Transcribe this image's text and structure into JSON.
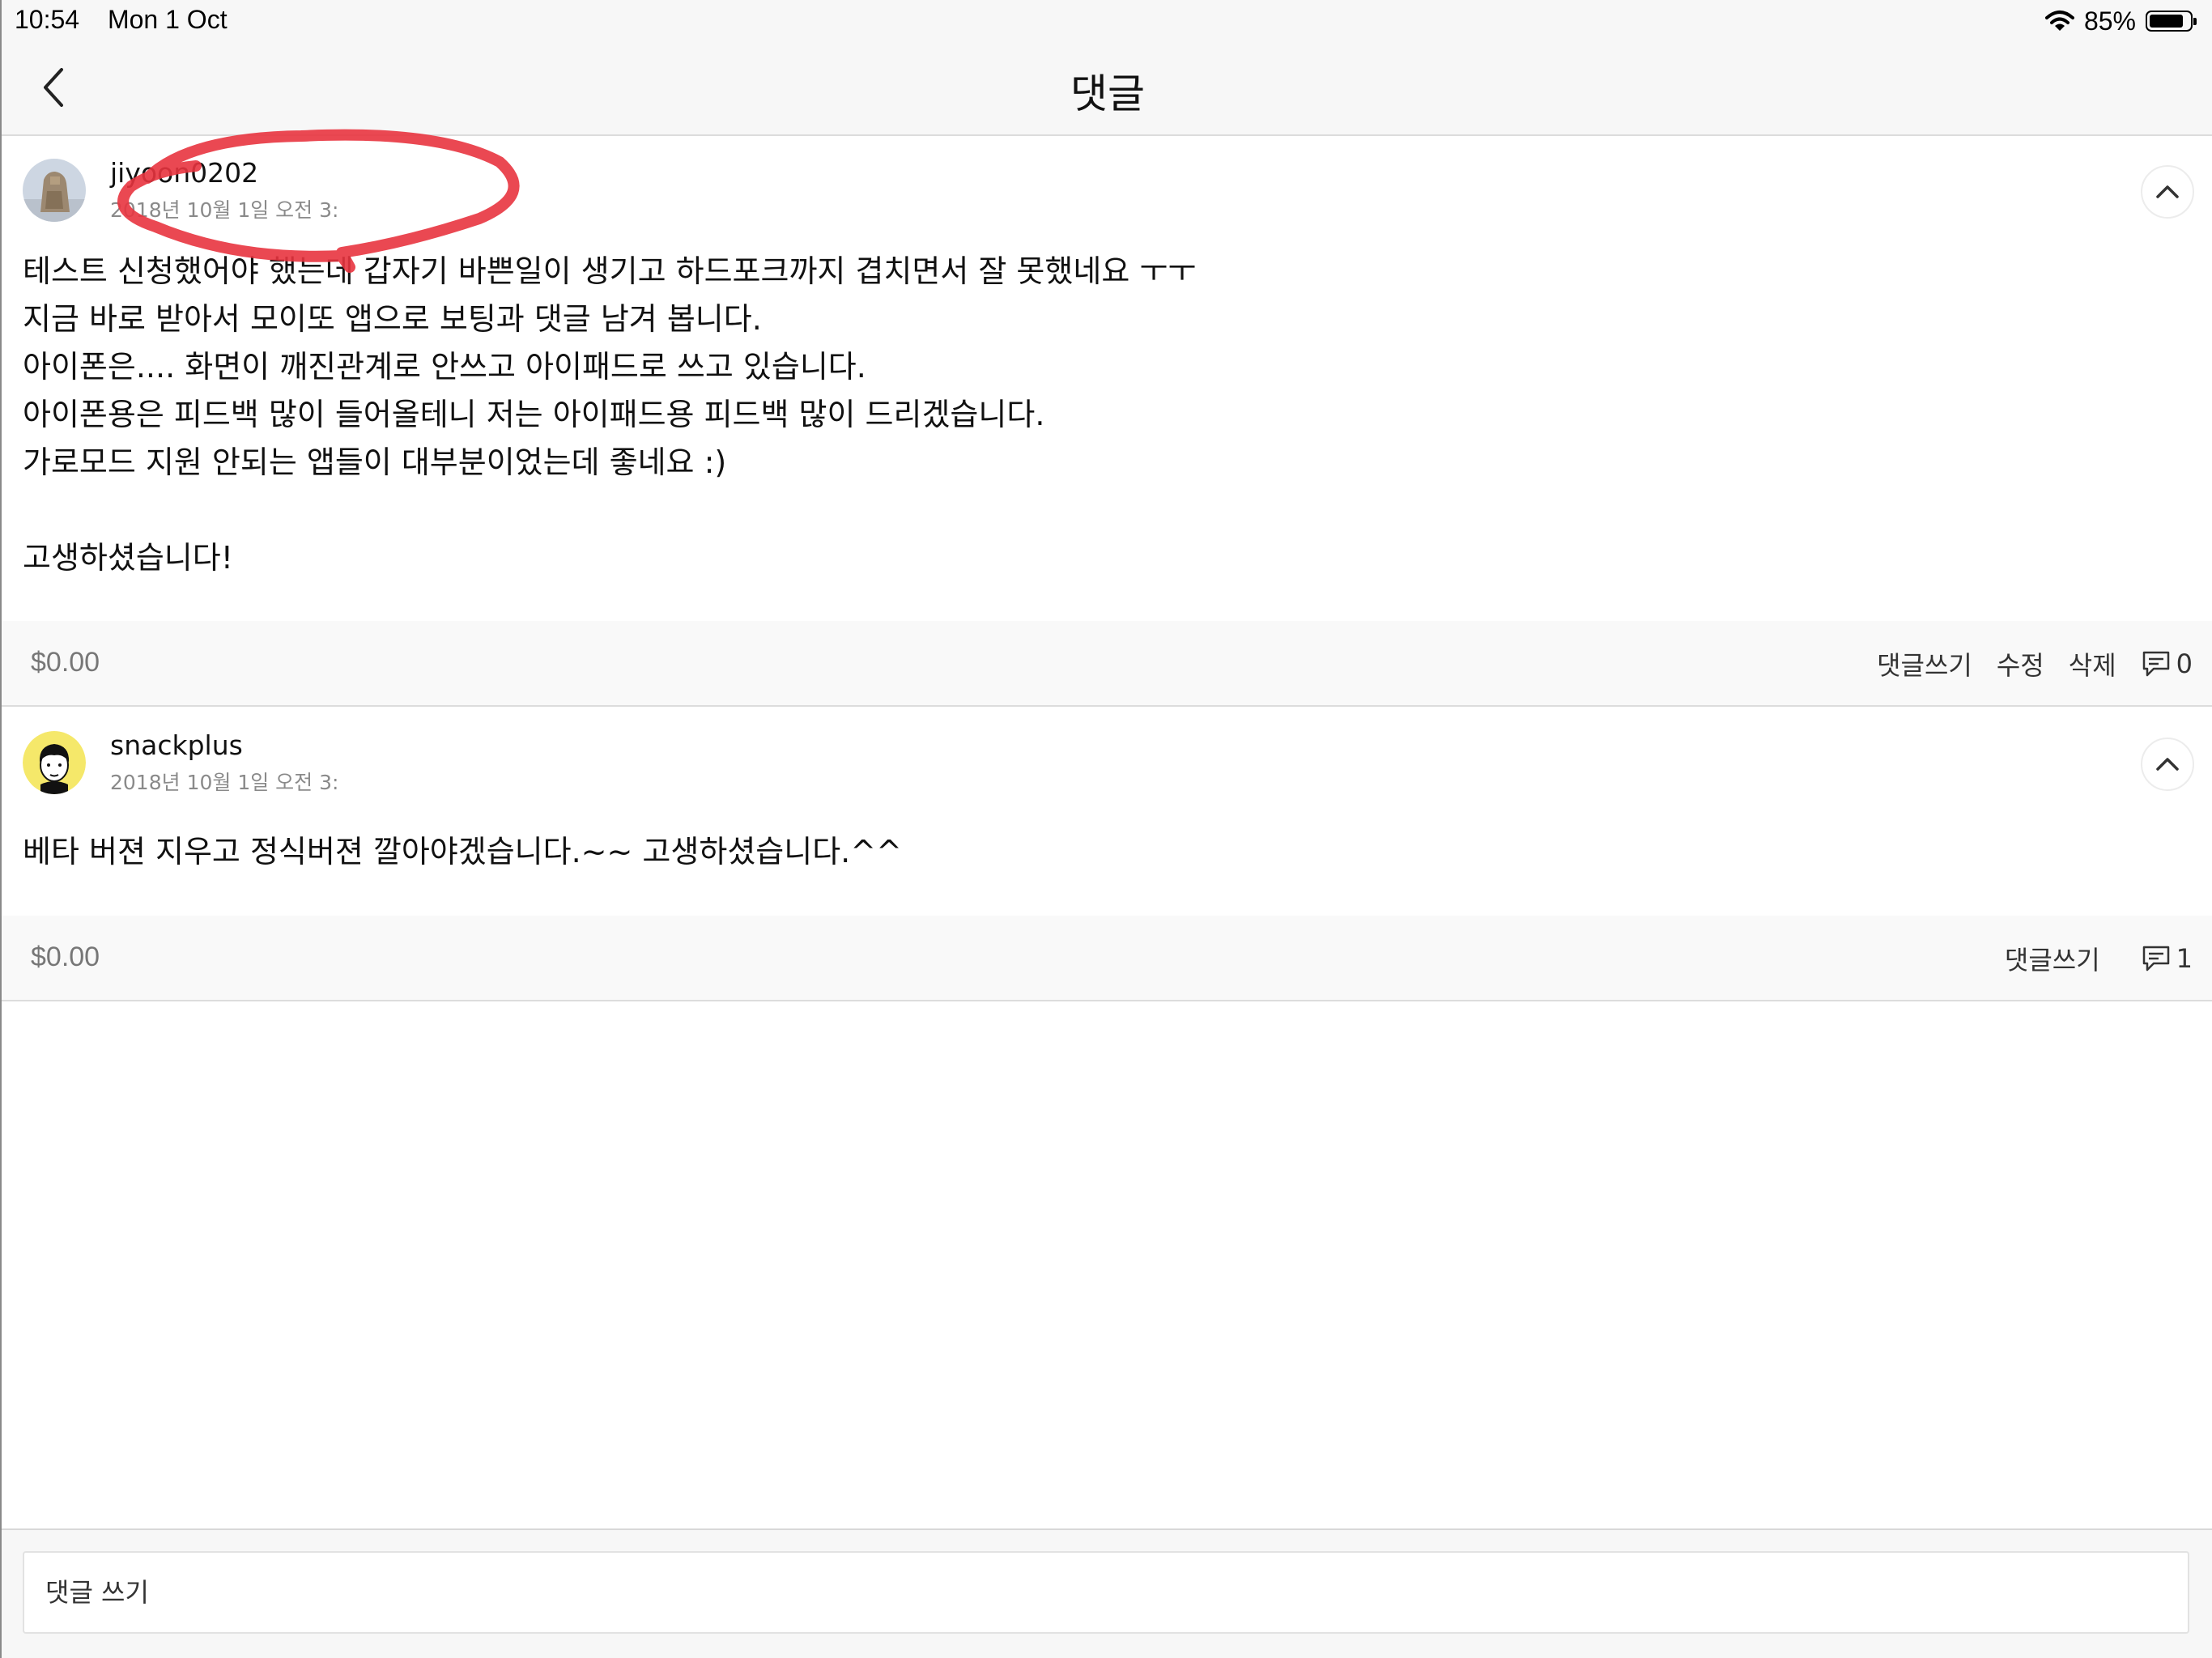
{
  "status_bar": {
    "time": "10:54",
    "date": "Mon 1 Oct",
    "battery_percent": "85%",
    "battery_level": 0.85
  },
  "nav": {
    "title": "댓글",
    "back_icon": "chevron-left-icon"
  },
  "comments": [
    {
      "username": "jiyoon0202",
      "timestamp": "2018년 10월 1일 오전 3:",
      "body": "테스트 신청했어야 했는데 갑자기 바쁜일이 생기고 하드포크까지 겹치면서 잘 못했네요 ㅜㅜ\n지금 바로 받아서 모이또 앱으로 보팅과 댓글 남겨 봅니다.\n아이폰은.... 화면이 깨진관계로 안쓰고 아이패드로 쓰고 있습니다.\n아이폰용은 피드백 많이 들어올테니 저는 아이패드용 피드백 많이 드리겠습니다.\n가로모드 지원 안되는 앱들이 대부분이었는데 좋네요 :)\n\n고생하셨습니다!",
      "price": "$0.00",
      "actions": {
        "reply": "댓글쓰기",
        "edit": "수정",
        "delete": "삭제"
      },
      "reply_count": "0"
    },
    {
      "username": "snackplus",
      "timestamp": "2018년 10월 1일 오전 3:",
      "body": "베타 버젼 지우고 정식버젼 깔아야겠습니다.~~ 고생하셨습니다.^^",
      "price": "$0.00",
      "actions": {
        "reply": "댓글쓰기"
      },
      "reply_count": "1"
    }
  ],
  "input": {
    "placeholder": "댓글 쓰기",
    "value": ""
  },
  "colors": {
    "annotation_red": "#e8343f",
    "secondary_text": "#8a8a8a",
    "footer_bg": "#f9f9f9"
  }
}
